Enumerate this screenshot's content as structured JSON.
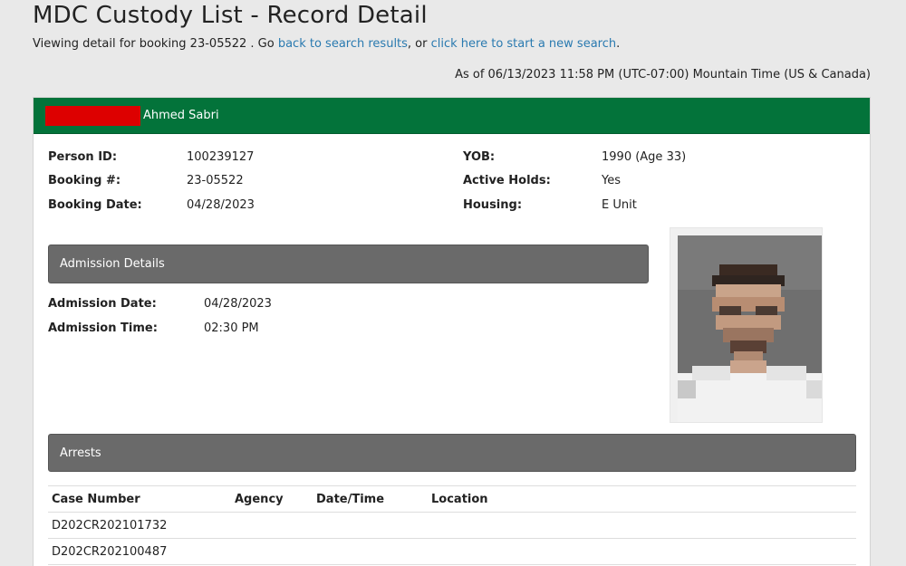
{
  "page": {
    "title": "MDC Custody List - Record Detail",
    "subline_prefix": "Viewing detail for booking 23-05522 . Go ",
    "back_link": "back to search results",
    "subline_middle": ", or ",
    "new_search_link": "click here to start a new search",
    "subline_suffix": ".",
    "as_of": "As of 06/13/2023 11:58 PM (UTC-07:00) Mountain Time (US & Canada)"
  },
  "record": {
    "header_name": "Ahmed Sabri",
    "header_color": "#03733a",
    "redaction_color": "#dd0000",
    "person_id_label": "Person ID:",
    "person_id": "100239127",
    "booking_no_label": "Booking #:",
    "booking_no": "23-05522",
    "booking_date_label": "Booking Date:",
    "booking_date": "04/28/2023",
    "yob_label": "YOB:",
    "yob": "1990 (Age 33)",
    "active_holds_label": "Active Holds:",
    "active_holds": "Yes",
    "housing_label": "Housing:",
    "housing": "E Unit"
  },
  "admission": {
    "section_title": "Admission Details",
    "date_label": "Admission Date:",
    "date": "04/28/2023",
    "time_label": "Admission Time:",
    "time": "02:30 PM"
  },
  "arrests": {
    "section_title": "Arrests",
    "columns": [
      "Case Number",
      "Agency",
      "Date/Time",
      "Location"
    ],
    "rows": [
      [
        "D202CR202101732",
        "",
        "",
        ""
      ],
      [
        "D202CR202100487",
        "",
        "",
        ""
      ]
    ]
  },
  "photo": {
    "icon": "mugshot-photo-pixelated"
  }
}
